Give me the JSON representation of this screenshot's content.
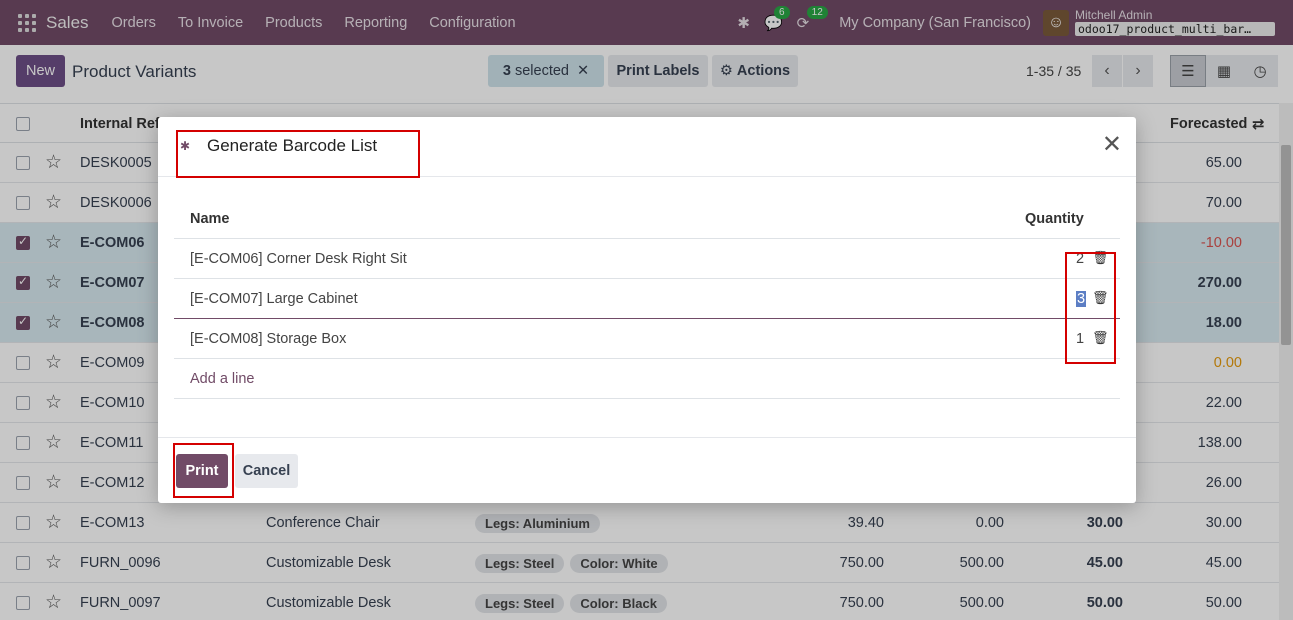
{
  "navbar": {
    "app_name": "Sales",
    "menu": [
      "Orders",
      "To Invoice",
      "Products",
      "Reporting",
      "Configuration"
    ],
    "messages_count": "6",
    "activities_count": "12",
    "company": "My Company (San Francisco)",
    "user_name": "Mitchell Admin",
    "database": "odoo17_product_multi_bar…"
  },
  "control": {
    "new_label": "New",
    "title": "Product Variants",
    "selected_count": "3",
    "selected_label": "selected",
    "print_labels": "Print Labels",
    "actions": "Actions",
    "pager": "1-35 / 35"
  },
  "list": {
    "headers": {
      "internal_ref": "Internal Ref",
      "forecasted": "Forecasted"
    },
    "rows": [
      {
        "ref": "DESK0005",
        "name": "",
        "tags": [],
        "price": "",
        "cost": "",
        "onhand": "",
        "forecast": "65.00",
        "selected": false
      },
      {
        "ref": "DESK0006",
        "name": "",
        "tags": [],
        "price": "",
        "cost": "",
        "onhand": "",
        "forecast": "70.00",
        "selected": false
      },
      {
        "ref": "E-COM06",
        "name": "",
        "tags": [],
        "price": "",
        "cost": "",
        "onhand": "",
        "forecast": "-10.00",
        "selected": true
      },
      {
        "ref": "E-COM07",
        "name": "",
        "tags": [],
        "price": "",
        "cost": "",
        "onhand": "",
        "forecast": "270.00",
        "selected": true
      },
      {
        "ref": "E-COM08",
        "name": "",
        "tags": [],
        "price": "",
        "cost": "",
        "onhand": "",
        "forecast": "18.00",
        "selected": true
      },
      {
        "ref": "E-COM09",
        "name": "",
        "tags": [],
        "price": "",
        "cost": "",
        "onhand": "",
        "forecast": "0.00",
        "selected": false
      },
      {
        "ref": "E-COM10",
        "name": "",
        "tags": [],
        "price": "",
        "cost": "",
        "onhand": "",
        "forecast": "22.00",
        "selected": false
      },
      {
        "ref": "E-COM11",
        "name": "",
        "tags": [],
        "price": "",
        "cost": "",
        "onhand": "",
        "forecast": "138.00",
        "selected": false
      },
      {
        "ref": "E-COM12",
        "name": "",
        "tags": [],
        "price": "",
        "cost": "",
        "onhand": "",
        "forecast": "26.00",
        "selected": false
      },
      {
        "ref": "E-COM13",
        "name": "Conference Chair",
        "tags": [
          "Legs: Aluminium"
        ],
        "price": "39.40",
        "cost": "0.00",
        "onhand": "30.00",
        "forecast": "30.00",
        "selected": false
      },
      {
        "ref": "FURN_0096",
        "name": "Customizable Desk",
        "tags": [
          "Legs: Steel",
          "Color: White"
        ],
        "price": "750.00",
        "cost": "500.00",
        "onhand": "45.00",
        "forecast": "45.00",
        "selected": false
      },
      {
        "ref": "FURN_0097",
        "name": "Customizable Desk",
        "tags": [
          "Legs: Steel",
          "Color: Black"
        ],
        "price": "750.00",
        "cost": "500.00",
        "onhand": "50.00",
        "forecast": "50.00",
        "selected": false
      }
    ]
  },
  "modal": {
    "title": "Generate Barcode List",
    "col_name": "Name",
    "col_quantity": "Quantity",
    "lines": [
      {
        "name": "[E-COM06] Corner Desk Right Sit",
        "qty": "2"
      },
      {
        "name": "[E-COM07] Large Cabinet",
        "qty": "3"
      },
      {
        "name": "[E-COM08] Storage Box",
        "qty": "1"
      }
    ],
    "add_line": "Add a line",
    "print": "Print",
    "cancel": "Cancel"
  },
  "colors": {
    "brand": "#714B67",
    "highlight": "#d40000",
    "negative": "#d9534f",
    "warning": "#e69a0c"
  }
}
